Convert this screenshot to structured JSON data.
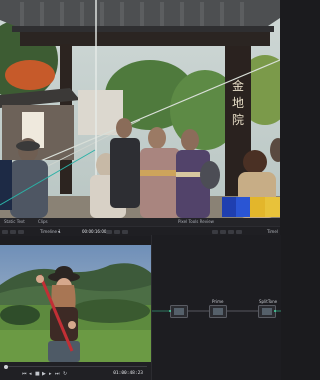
{
  "viewer_top": {
    "kanji": "金地院",
    "swatches": [
      "#1f3fb0",
      "#2a55d4",
      "#e3b62b",
      "#e8c23a"
    ]
  },
  "status_bar": {
    "left_a": "Static Text",
    "left_b": "Clips",
    "center_title": "Pixel Tools Review"
  },
  "toolbar": {
    "timeline_name": "Timeline 1",
    "timecode": "00:00:16:00",
    "right_label": "Timel"
  },
  "node_editor": {
    "nodes": [
      {
        "label": ""
      },
      {
        "label": "Prime"
      },
      {
        "label": "SplitTone"
      }
    ]
  },
  "transport": {
    "timecode": "01:00:48:23",
    "controls": [
      "skip-start-icon",
      "step-back-icon",
      "stop-icon",
      "play-icon",
      "step-forward-icon",
      "skip-end-icon",
      "loop-icon"
    ]
  }
}
